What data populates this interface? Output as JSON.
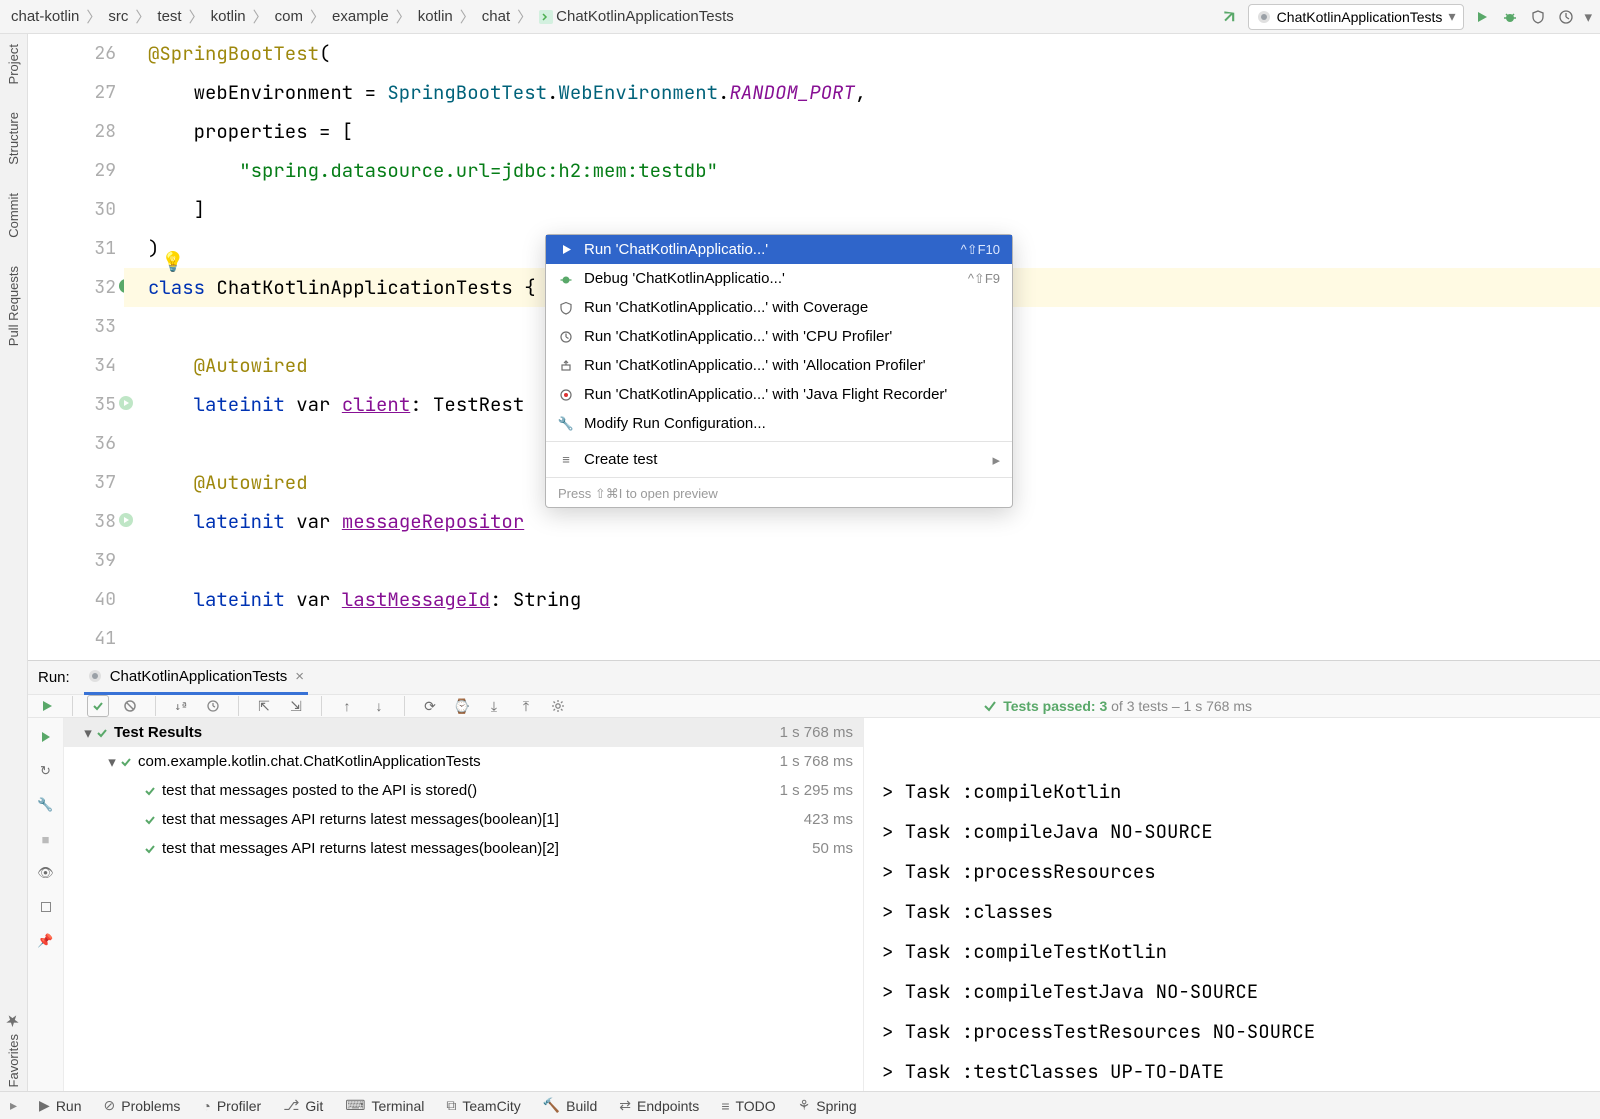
{
  "breadcrumbs": [
    "chat-kotlin",
    "src",
    "test",
    "kotlin",
    "com",
    "example",
    "kotlin",
    "chat",
    "ChatKotlinApplicationTests"
  ],
  "run_config": "ChatKotlinApplicationTests",
  "left_tabs": [
    "Project",
    "Structure",
    "Commit",
    "Pull Requests",
    "Favorites"
  ],
  "gutter": {
    "lines": [
      "26",
      "27",
      "28",
      "29",
      "30",
      "31",
      "32",
      "33",
      "34",
      "35",
      "36",
      "37",
      "38",
      "39",
      "40",
      "41"
    ]
  },
  "code": {
    "l26_anno": "@SpringBootTest",
    "l26_par": "(",
    "l27a": "webEnvironment = ",
    "l27b": "SpringBootTest",
    "l27c": ".",
    "l27d": "WebEnvironment",
    "l27e": ".",
    "l27f": "RANDOM_PORT",
    "l27g": ",",
    "l28a": "properties = [",
    "l29str": "\"spring.datasource.url=jdbc:h2:mem:testdb\"",
    "l30": "]",
    "l31": ")",
    "l32a": "class",
    "l32b": " ChatKotlinApplicationTests {",
    "l34": "@Autowired",
    "l35a": "lateinit",
    "l35b": " var ",
    "l35c": "client",
    "l35d": ": TestRest",
    "l37": "@Autowired",
    "l38a": "lateinit",
    "l38b": " var ",
    "l38c": "messageRepositor",
    "l40a": "lateinit",
    "l40b": " var ",
    "l40c": "lastMessageId",
    "l40d": ": String"
  },
  "ctx": {
    "items": [
      {
        "icon": "play-green",
        "label": "Run 'ChatKotlinApplicatio...'",
        "short": "^⇧F10"
      },
      {
        "icon": "bug-green",
        "label": "Debug 'ChatKotlinApplicatio...'",
        "short": "^⇧F9"
      },
      {
        "icon": "coverage",
        "label": "Run 'ChatKotlinApplicatio...' with Coverage",
        "short": ""
      },
      {
        "icon": "cpu",
        "label": "Run 'ChatKotlinApplicatio...' with 'CPU Profiler'",
        "short": ""
      },
      {
        "icon": "alloc",
        "label": "Run 'ChatKotlinApplicatio...' with 'Allocation Profiler'",
        "short": ""
      },
      {
        "icon": "jfr",
        "label": "Run 'ChatKotlinApplicatio...' with 'Java Flight Recorder'",
        "short": ""
      },
      {
        "icon": "wrench",
        "label": "Modify Run Configuration...",
        "short": ""
      }
    ],
    "create_test": "Create test",
    "footer": "Press ⇧⌘I to open preview"
  },
  "run_panel": {
    "title": "Run:",
    "tab": "ChatKotlinApplicationTests",
    "status_prefix": "Tests passed: ",
    "status_bold": "3",
    "status_rest": " of 3 tests – 1 s 768 ms",
    "tree": [
      {
        "depth": 0,
        "name": "Test Results",
        "time": "1 s 768 ms",
        "twisty": true,
        "root": true,
        "bold": true
      },
      {
        "depth": 1,
        "name": "com.example.kotlin.chat.ChatKotlinApplicationTests",
        "time": "1 s 768 ms",
        "twisty": true
      },
      {
        "depth": 2,
        "name": "test that messages posted to the API is stored()",
        "time": "1 s 295 ms"
      },
      {
        "depth": 2,
        "name": "test that messages API returns latest messages(boolean)[1]",
        "time": "423 ms"
      },
      {
        "depth": 2,
        "name": "test that messages API returns latest messages(boolean)[2]",
        "time": "50 ms"
      }
    ],
    "console": [
      "> Task :compileKotlin",
      "> Task :compileJava NO-SOURCE",
      "> Task :processResources",
      "> Task :classes",
      "> Task :compileTestKotlin",
      "> Task :compileTestJava NO-SOURCE",
      "> Task :processTestResources NO-SOURCE",
      "> Task :testClasses UP-TO-DATE"
    ]
  },
  "statusbar": [
    "Run",
    "Problems",
    "Profiler",
    "Git",
    "Terminal",
    "TeamCity",
    "Build",
    "Endpoints",
    "TODO",
    "Spring"
  ]
}
